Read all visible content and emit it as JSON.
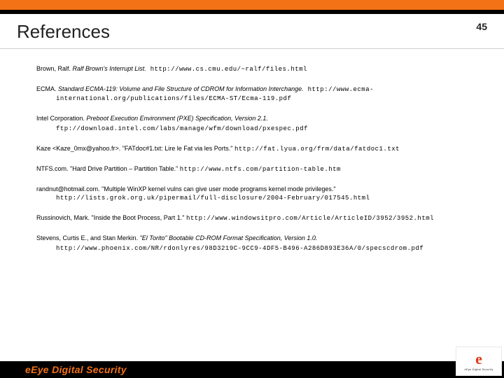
{
  "header": {
    "title": "References",
    "page_number": "45"
  },
  "references": [
    {
      "author": "Brown, Ralf. ",
      "title_italic": "Ralf Brown's Interrupt List.",
      "url": " http://www.cs.cmu.edu/~ralf/files.html"
    },
    {
      "author": "ECMA. ",
      "title_italic": "Standard ECMA-119: Volume and File Structure of CDROM for Information Interchange.",
      "url": " http://www.ecma-international.org/publications/files/ECMA-ST/Ecma-119.pdf"
    },
    {
      "author": "Intel Corporation. ",
      "title_italic": "Preboot Execution Environment (PXE) Specification, Version 2.1.",
      "url": " ftp://download.intel.com/labs/manage/wfm/download/pxespec.pdf"
    },
    {
      "author": "Kaze <Kaze_0mx@yahoo.fr>. \"FATdoc#1.txt: Lire le Fat via les Ports.\" ",
      "title_italic": "",
      "url": "http://fat.lyua.org/frm/data/fatdoc1.txt"
    },
    {
      "author": "NTFS.com. \"Hard Drive Partition – Partition Table.\" ",
      "title_italic": "",
      "url": "http://www.ntfs.com/partition-table.htm"
    },
    {
      "author": "randnut@hotmail.com. \"Multiple WinXP kernel vulns can give user mode programs kernel mode privileges.\" ",
      "title_italic": "",
      "url": "http://lists.grok.org.uk/pipermail/full-disclosure/2004-February/017545.html"
    },
    {
      "author": "Russinovich, Mark. \"Inside the Boot Process, Part 1.\" ",
      "title_italic": "",
      "url": "http://www.windowsitpro.com/Article/ArticleID/3952/3952.html"
    },
    {
      "author": "Stevens, Curtis E., and Stan Merkin. ",
      "title_italic": "\"El Torito\" Bootable CD-ROM Format Specification, Version 1.0.",
      "url": " http://www.phoenix.com/NR/rdonlyres/98D3219C-9CC9-4DF5-B496-A286D893E36A/0/specscdrom.pdf"
    }
  ],
  "footer": {
    "brand": "eEye Digital Security",
    "logo_letter": "e",
    "logo_sub": "eEye Digital Security"
  }
}
